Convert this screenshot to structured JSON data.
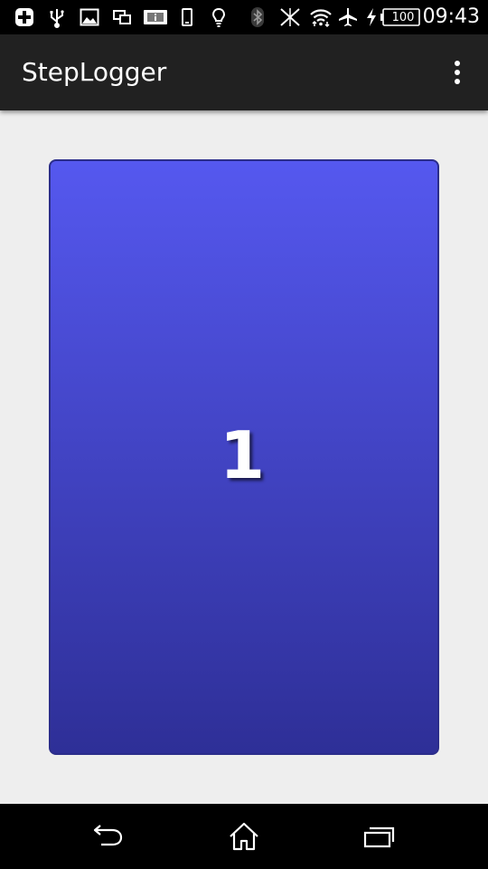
{
  "status_bar": {
    "battery_level": "100",
    "time": "09:43"
  },
  "app_bar": {
    "title": "StepLogger",
    "overflow_icon": "more-vertical-icon"
  },
  "main": {
    "step_count": "1",
    "card_colors": {
      "top": "#5558ef",
      "bottom": "#2e2f97",
      "border": "#2b2d8a"
    }
  },
  "nav_bar": {
    "back_icon": "back-icon",
    "home_icon": "home-icon",
    "recents_icon": "recent-apps-icon"
  }
}
